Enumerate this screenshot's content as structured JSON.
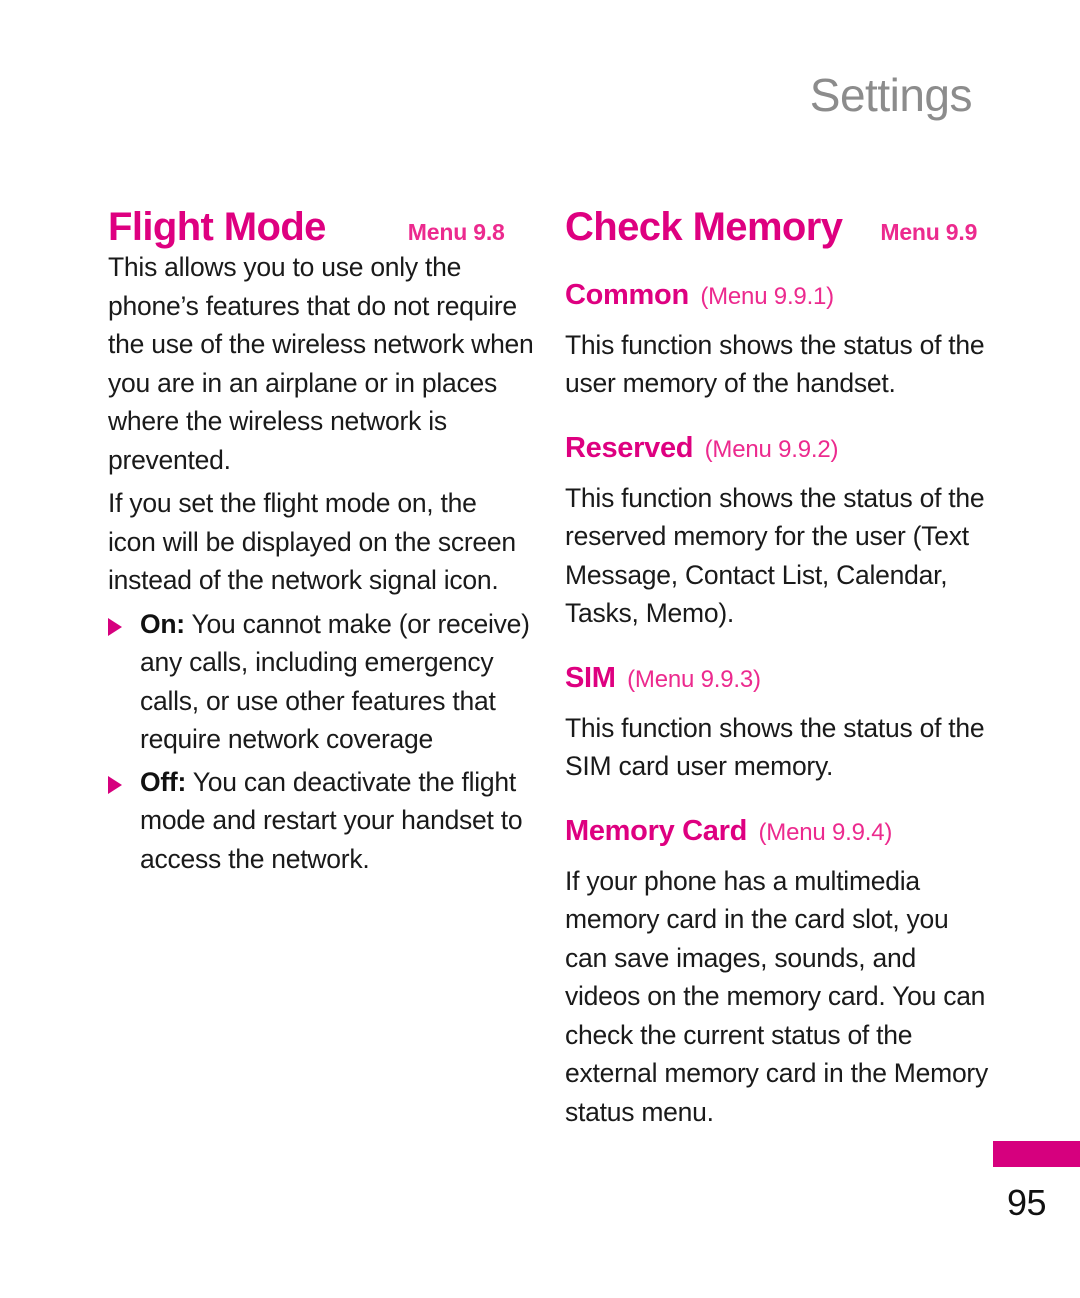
{
  "header": {
    "running_title": "Settings"
  },
  "colors": {
    "heading_magenta": "#DE0080",
    "menu_pink": "#EC2A8E",
    "bullet_magenta": "#D6007E",
    "header_gray": "#8C8C8C",
    "body_black": "#1A1A1A",
    "edge_tab": "#D6007E"
  },
  "left_column": {
    "title": "Flight Mode",
    "menu_ref": "Menu 9.8",
    "paragraphs": [
      "This allows you to use only the phone’s features that do not require the use of the wireless network when you are in an airplane or in places where the wireless network is prevented.",
      "If you set the flight mode on, the"
    ],
    "icon_sentence_tail": "icon will be displayed on the screen instead of the network signal icon.",
    "bullets": [
      {
        "term": "On:",
        "text": "You cannot make (or receive) any calls, including emergency calls, or use other features that require network coverage"
      },
      {
        "term": "Off:",
        "text": "You can deactivate the flight mode and restart your handset to access the network."
      }
    ]
  },
  "right_column": {
    "title": "Check Memory",
    "menu_ref": "Menu 9.9",
    "subsections": [
      {
        "name": "Common",
        "menu_ref": "(Menu 9.9.1)",
        "body": "This function shows the status of the user memory of the handset."
      },
      {
        "name": "Reserved",
        "menu_ref": "(Menu 9.9.2)",
        "body": "This function shows the status of the reserved memory for the user (Text Message, Contact List, Calendar, Tasks, Memo)."
      },
      {
        "name": "SIM",
        "menu_ref": "(Menu 9.9.3)",
        "body": "This function shows the status of the SIM card user memory."
      },
      {
        "name": "Memory Card",
        "menu_ref": "(Menu 9.9.4)",
        "body": "If your phone has a multimedia memory card in the card slot, you can save images, sounds, and videos on the memory card. You can check the current status of the external memory card in the Memory status menu."
      }
    ]
  },
  "footer": {
    "page_number": "95"
  }
}
